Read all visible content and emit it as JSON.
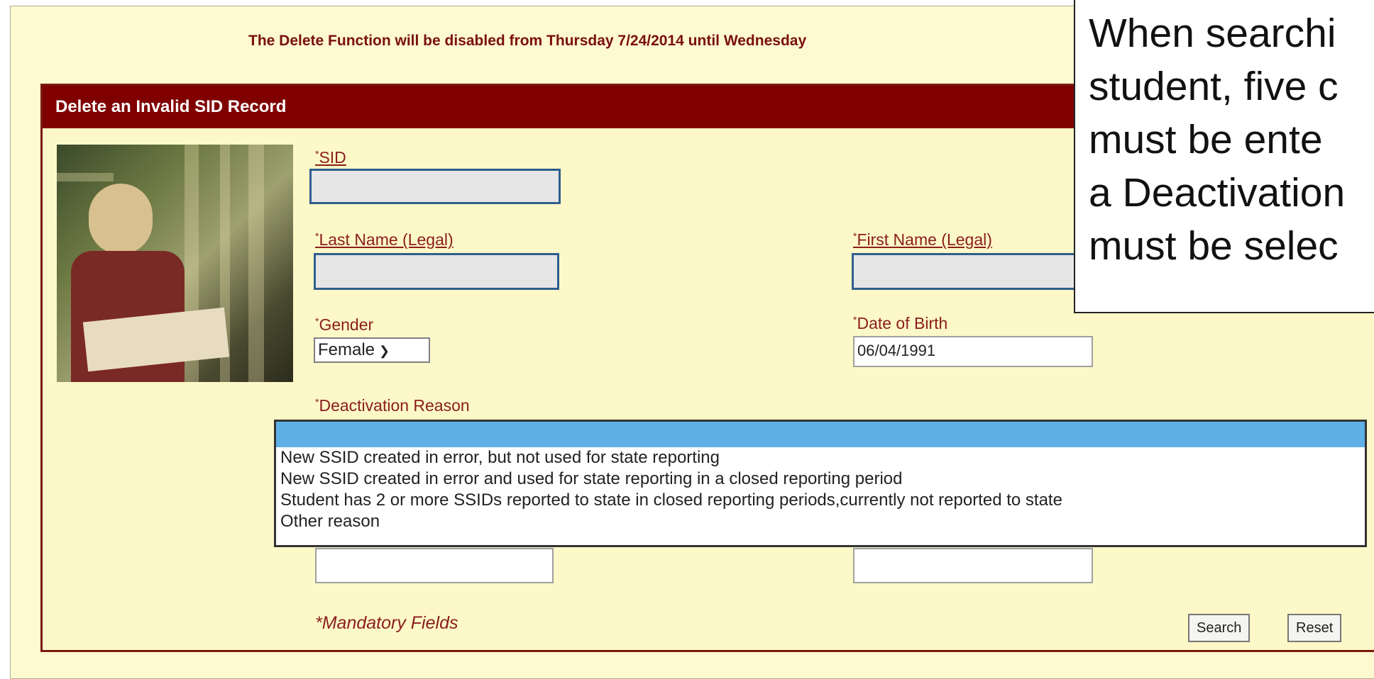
{
  "notice": "The Delete Function will be disabled from Thursday 7/24/2014 until Wednesday",
  "panel": {
    "title": "Delete an Invalid SID Record"
  },
  "fields": {
    "sid_label": "SID",
    "last_name_label": "Last Name (Legal)",
    "first_name_label": "First Name (Legal)",
    "gender_label": "Gender",
    "gender_value": "Female",
    "dob_label": "Date of Birth",
    "dob_value": "06/04/1991",
    "deactivation_label": "Deactivation Reason",
    "required_marker": "*"
  },
  "deactivation_options": [
    "New SSID created in error, but not used for state reporting",
    "New SSID created in error and used for state reporting in a closed reporting period",
    "Student has 2 or more SSIDs reported to state in closed reporting periods,currently not reported to state",
    "Other reason"
  ],
  "footer": {
    "mandatory_text": "*Mandatory Fields",
    "search_label": "Search",
    "reset_label": "Reset"
  },
  "callout": {
    "lines": [
      "When searchi",
      "student, five c",
      "must be ente",
      "a Deactivation",
      "must be selec"
    ]
  },
  "colors": {
    "header": "#800000",
    "background": "#fdf9d0",
    "label": "#8a1e1e",
    "selected": "#5eb0e6"
  }
}
